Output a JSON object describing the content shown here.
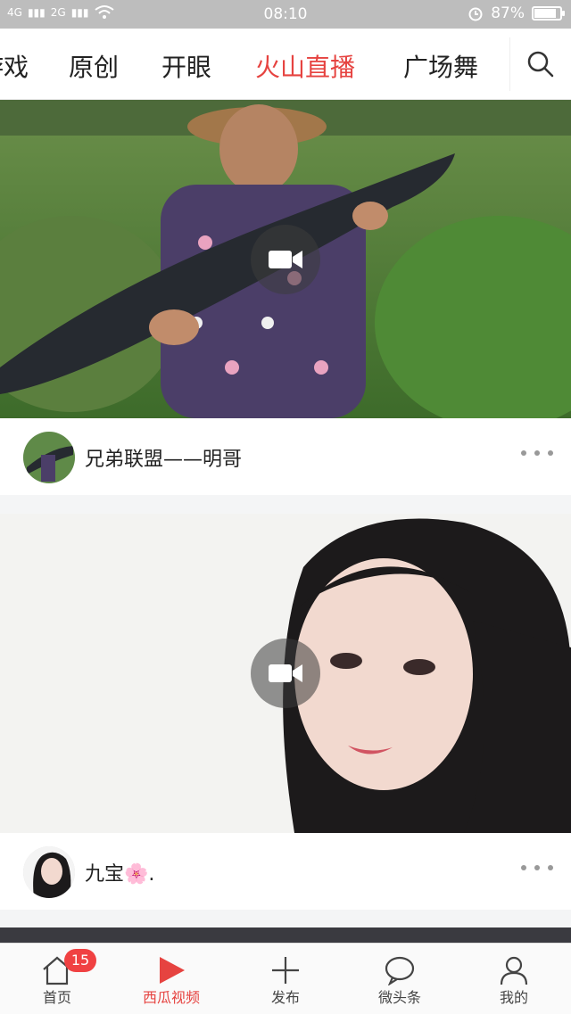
{
  "status_bar": {
    "signal_1": "4G",
    "signal_2": "2G",
    "time": "08:10",
    "battery": "87%",
    "battery_level": 0.87
  },
  "tabs": [
    {
      "label": "游戏",
      "active": false
    },
    {
      "label": "原创",
      "active": false
    },
    {
      "label": "开眼",
      "active": false
    },
    {
      "label": "火山直播",
      "active": true
    },
    {
      "label": "广场舞",
      "active": false
    }
  ],
  "icons": {
    "search": "search-icon",
    "video": "video-camera-icon",
    "more": "more-dots-icon"
  },
  "feed": [
    {
      "author": "兄弟联盟——明哥",
      "thumbnail": "man holding large fish outdoors"
    },
    {
      "author": "九宝🌸.",
      "thumbnail": "young woman selfie"
    }
  ],
  "bottom_nav": [
    {
      "label": "首页",
      "icon": "home-icon",
      "badge": "15"
    },
    {
      "label": "西瓜视频",
      "icon": "play-icon",
      "active": true
    },
    {
      "label": "发布",
      "icon": "plus-icon"
    },
    {
      "label": "微头条",
      "icon": "chat-bubble-icon"
    },
    {
      "label": "我的",
      "icon": "user-icon"
    }
  ],
  "colors": {
    "accent": "#e64340",
    "badge": "#f04142",
    "status_bar": "#bdbdbd"
  }
}
